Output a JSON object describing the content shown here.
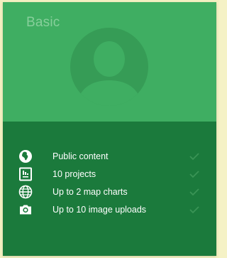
{
  "plan": {
    "title": "Basic",
    "avatar_icon": "person-avatar-icon"
  },
  "features": [
    {
      "icon": "globe-africa-icon",
      "label": "Public content",
      "included": true
    },
    {
      "icon": "chart-document-icon",
      "label": "10 projects",
      "included": true
    },
    {
      "icon": "globe-grid-icon",
      "label": "Up to 2 map charts",
      "included": true
    },
    {
      "icon": "camera-icon",
      "label": "Up to 10 image uploads",
      "included": true
    }
  ],
  "colors": {
    "header_bg": "#3fae62",
    "body_bg": "#1b7a3c",
    "title_text": "#87cf9b",
    "check": "#3a9456"
  }
}
